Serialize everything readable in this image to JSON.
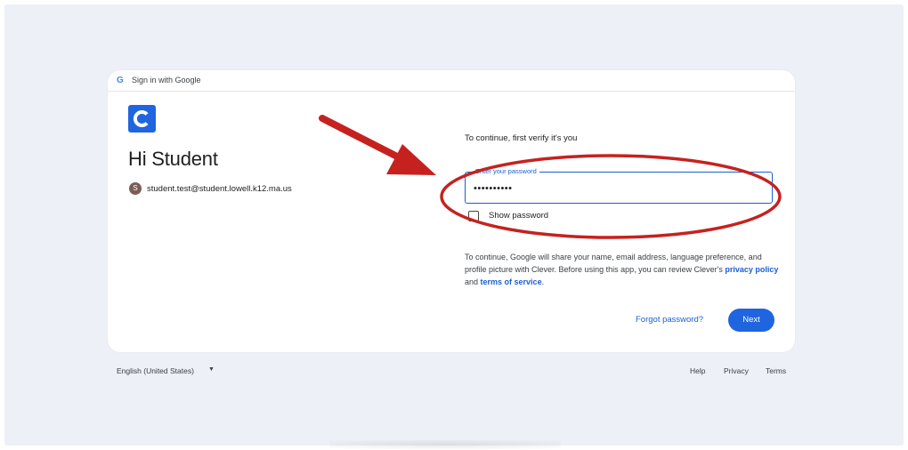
{
  "header": {
    "google_logo": "G",
    "title": "Sign in with Google"
  },
  "account": {
    "app_logo": "clever-logo",
    "greeting": "Hi Student",
    "avatar_initial": "S",
    "email": "student.test@student.lowell.k12.ma.us"
  },
  "form": {
    "prompt": "To continue, first verify it's you",
    "password_label": "Enter your password",
    "password_value": "••••••••••",
    "show_password_label": "Show password",
    "show_password_checked": false
  },
  "disclaimer": {
    "text_before": "To continue, Google will share your name, email address, language preference, and profile picture with Clever. Before using this app, you can review Clever's ",
    "privacy_link": "privacy policy",
    "and": " and ",
    "terms_link": "terms of service",
    "end": "."
  },
  "actions": {
    "forgot_password": "Forgot password?",
    "next": "Next"
  },
  "footer": {
    "language": "English (United States)",
    "language_arrow": "▼",
    "help": "Help",
    "privacy": "Privacy",
    "terms": "Terms"
  },
  "colors": {
    "accent": "#1f65e0",
    "annotation": "#c5221f",
    "background": "#edf0f6"
  }
}
